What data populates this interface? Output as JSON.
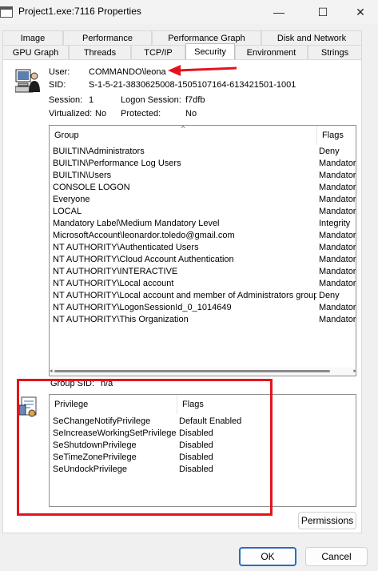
{
  "window": {
    "title": "Project1.exe:7116 Properties"
  },
  "controls": {
    "minimize": "—",
    "maximize": "☐",
    "close": "✕"
  },
  "tabs_row1": [
    "Image",
    "Performance",
    "Performance Graph",
    "Disk and Network"
  ],
  "tabs_row2": [
    "GPU Graph",
    "Threads",
    "TCP/IP",
    "Security",
    "Environment",
    "Strings"
  ],
  "active_tab": "Security",
  "security": {
    "user_label": "User:",
    "user_value": "COMMANDO\\leona",
    "sid_label": "SID:",
    "sid_value": "S-1-5-21-3830625008-1505107164-613421501-1001",
    "session_label": "Session:",
    "session_value": "1",
    "logon_label": "Logon Session:",
    "logon_value": "f7dfb",
    "virtualized_label": "Virtualized:",
    "virtualized_value": "No",
    "protected_label": "Protected:",
    "protected_value": "No",
    "groups_header": {
      "group": "Group",
      "flags": "Flags"
    },
    "groups": [
      {
        "name": "BUILTIN\\Administrators",
        "flags": "Deny"
      },
      {
        "name": "BUILTIN\\Performance Log Users",
        "flags": "Mandator"
      },
      {
        "name": "BUILTIN\\Users",
        "flags": "Mandator"
      },
      {
        "name": "CONSOLE LOGON",
        "flags": "Mandator"
      },
      {
        "name": "Everyone",
        "flags": "Mandator"
      },
      {
        "name": "LOCAL",
        "flags": "Mandator"
      },
      {
        "name": "Mandatory Label\\Medium Mandatory Level",
        "flags": "Integrity"
      },
      {
        "name": "MicrosoftAccount\\leonardor.toledo@gmail.com",
        "flags": "Mandator"
      },
      {
        "name": "NT AUTHORITY\\Authenticated Users",
        "flags": "Mandator"
      },
      {
        "name": "NT AUTHORITY\\Cloud Account Authentication",
        "flags": "Mandator"
      },
      {
        "name": "NT AUTHORITY\\INTERACTIVE",
        "flags": "Mandator"
      },
      {
        "name": "NT AUTHORITY\\Local account",
        "flags": "Mandator"
      },
      {
        "name": "NT AUTHORITY\\Local account and member of Administrators group",
        "flags": "Deny"
      },
      {
        "name": "NT AUTHORITY\\LogonSessionId_0_1014649",
        "flags": "Mandator"
      },
      {
        "name": "NT AUTHORITY\\This Organization",
        "flags": "Mandator"
      }
    ],
    "group_sid_label": "Group SID:",
    "group_sid_value": "n/a",
    "privileges_header": {
      "privilege": "Privilege",
      "flags": "Flags"
    },
    "privileges": [
      {
        "name": "SeChangeNotifyPrivilege",
        "flags": "Default Enabled"
      },
      {
        "name": "SeIncreaseWorkingSetPrivilege",
        "flags": "Disabled"
      },
      {
        "name": "SeShutdownPrivilege",
        "flags": "Disabled"
      },
      {
        "name": "SeTimeZonePrivilege",
        "flags": "Disabled"
      },
      {
        "name": "SeUndockPrivilege",
        "flags": "Disabled"
      }
    ],
    "permissions_button": "Permissions"
  },
  "footer": {
    "ok": "OK",
    "cancel": "Cancel"
  },
  "colors": {
    "annotation_red": "#e4141e",
    "accent_blue": "#2a6cc4"
  }
}
